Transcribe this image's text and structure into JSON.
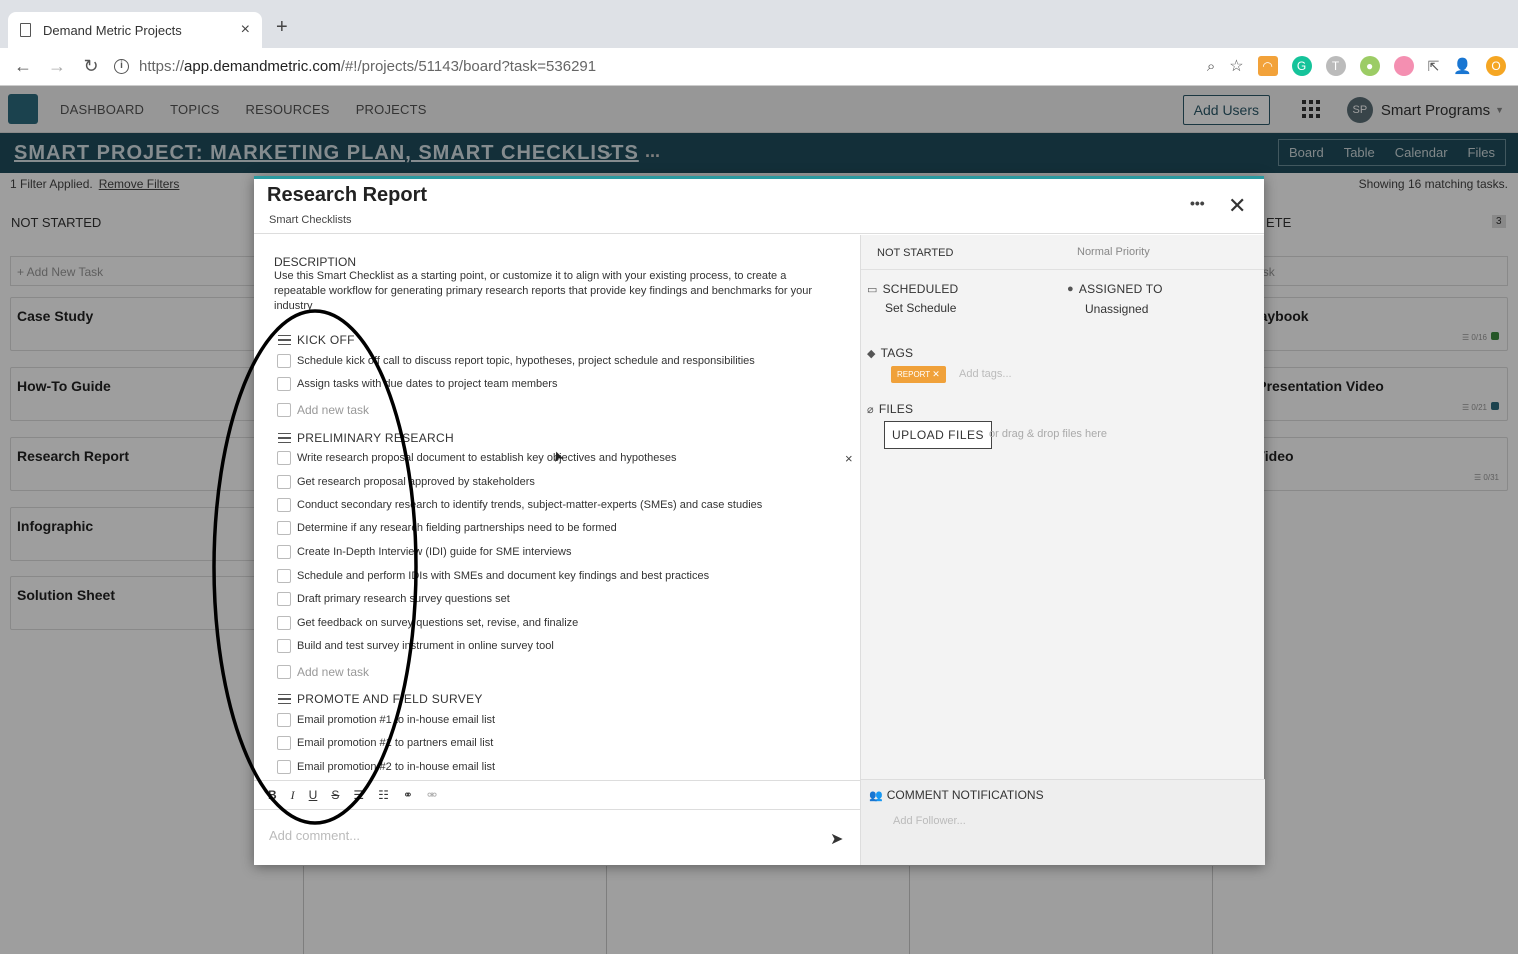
{
  "browser": {
    "tab_title": "Demand Metric Projects",
    "tab_close": "×",
    "new_tab": "+",
    "url_scheme": "https://",
    "url_host": "app.demandmetric.com",
    "url_path": "/#!/projects/51143/board?task=536291"
  },
  "app_nav": {
    "items": [
      "DASHBOARD",
      "TOPICS",
      "RESOURCES",
      "PROJECTS"
    ],
    "add_users": "Add Users",
    "user_initials": "SP",
    "user_name": "Smart Programs"
  },
  "project": {
    "title": "SMART PROJECT: MARKETING PLAN, SMART CHECKLISTS",
    "more": "...",
    "views": [
      "Board",
      "Table",
      "Calendar",
      "Files"
    ]
  },
  "filter": {
    "applied": "1 Filter Applied.",
    "remove": "Remove Filters",
    "showing": "Showing 16 matching tasks."
  },
  "board": {
    "col1_header": "NOT STARTED",
    "col_right_header": "ETE",
    "col_right_count": "3",
    "add_task": "+ Add New Task",
    "add_task_right": "New Task",
    "left_cards": [
      "Case Study",
      "How-To Guide",
      "Research Report",
      "Infographic",
      "Solution Sheet"
    ],
    "right_cards": [
      {
        "title": "les Playbook",
        "meta": "☰ 0/16"
      },
      {
        "title": "rded Presentation Video",
        "meta": "☰ 0/21"
      },
      {
        "title": "ated Video",
        "meta": "☰ 0/31"
      }
    ]
  },
  "modal": {
    "title": "Research Report",
    "subtitle": "Smart Checklists",
    "more": "•••",
    "close": "✕",
    "description_label": "DESCRIPTION",
    "description": "Use this Smart Checklist as a starting point, or customize it to align with your existing process, to create a repeatable workflow for generating primary research reports that provide key findings and benchmarks for your industry",
    "sections": [
      {
        "title": "KICK OFF",
        "items": [
          "Schedule kick off call to discuss report topic, hypotheses, project schedule and responsibilities",
          "Assign tasks with due dates to project team members"
        ]
      },
      {
        "title": "PRELIMINARY RESEARCH",
        "items": [
          "Write research proposal document to establish key objectives and hypotheses",
          "Get research proposal approved by stakeholders",
          "Conduct secondary research to identify trends, subject-matter-experts (SMEs) and case studies",
          "Determine if any research fielding partnerships need to be formed",
          "Create In-Depth Interview (IDI) guide for SME interviews",
          "Schedule and perform IDIs with SMEs and document key findings and best practices",
          "Draft primary research survey questions set",
          "Get feedback on survey questions set, revise, and finalize",
          "Build and test survey instrument in online survey tool"
        ]
      },
      {
        "title": "PROMOTE AND FIELD SURVEY",
        "items": [
          "Email promotion #1 to in-house email list",
          "Email promotion #1 to partners email list",
          "Email promotion #2 to in-house email list"
        ]
      }
    ],
    "add_new_task": "Add new task",
    "item_remove": "×",
    "editor_tools": [
      "B",
      "I",
      "U",
      "S"
    ],
    "comment_placeholder": "Add comment...",
    "status": "NOT STARTED",
    "priority": "Normal Priority",
    "scheduled_label": "SCHEDULED",
    "scheduled_value": "Set Schedule",
    "assigned_label": "ASSIGNED TO",
    "assigned_value": "Unassigned",
    "tags_label": "TAGS",
    "tag": "REPORT",
    "tag_placeholder": "Add tags...",
    "files_label": "FILES",
    "upload": "UPLOAD FILES",
    "drop_text": "or drag & drop files here",
    "notif_label": "COMMENT NOTIFICATIONS",
    "follower_placeholder": "Add Follower..."
  }
}
